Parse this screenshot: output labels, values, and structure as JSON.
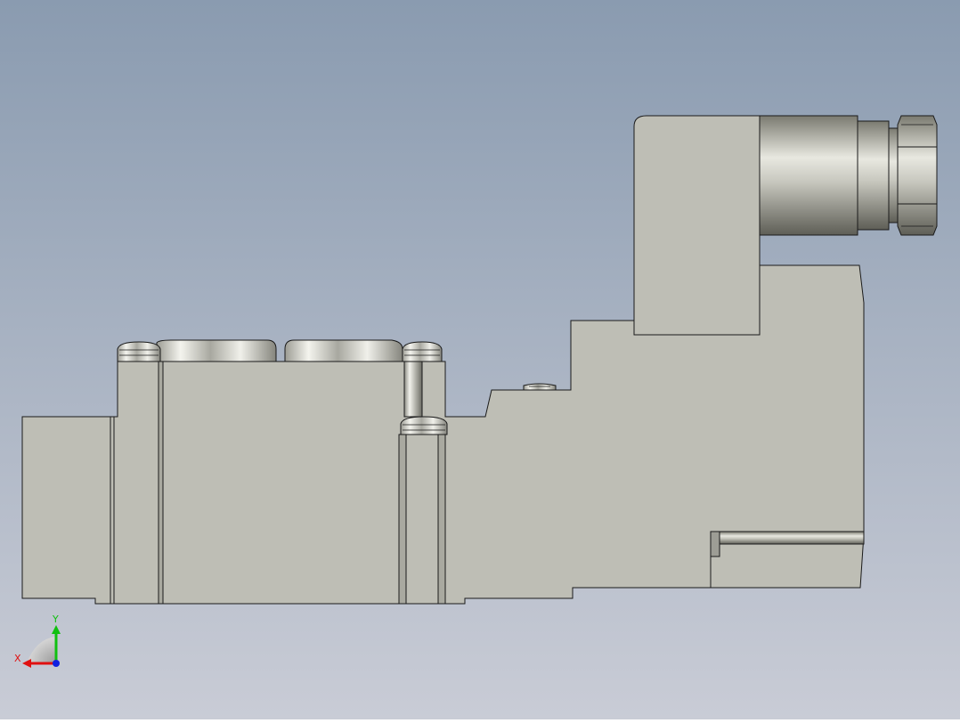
{
  "viewport": {
    "background_top": "#8a9bb0",
    "background_bottom": "#c9ccd6"
  },
  "model": {
    "part_fill": "#bebeb5",
    "part_stroke": "#1a1a1a",
    "cylinder_dark": "#6f6f66",
    "cylinder_light": "#f2f2ec"
  },
  "triad": {
    "x_label": "X",
    "y_label": "Y",
    "x_color": "#e01010",
    "y_color": "#10c010",
    "z_color": "#1020e0"
  }
}
